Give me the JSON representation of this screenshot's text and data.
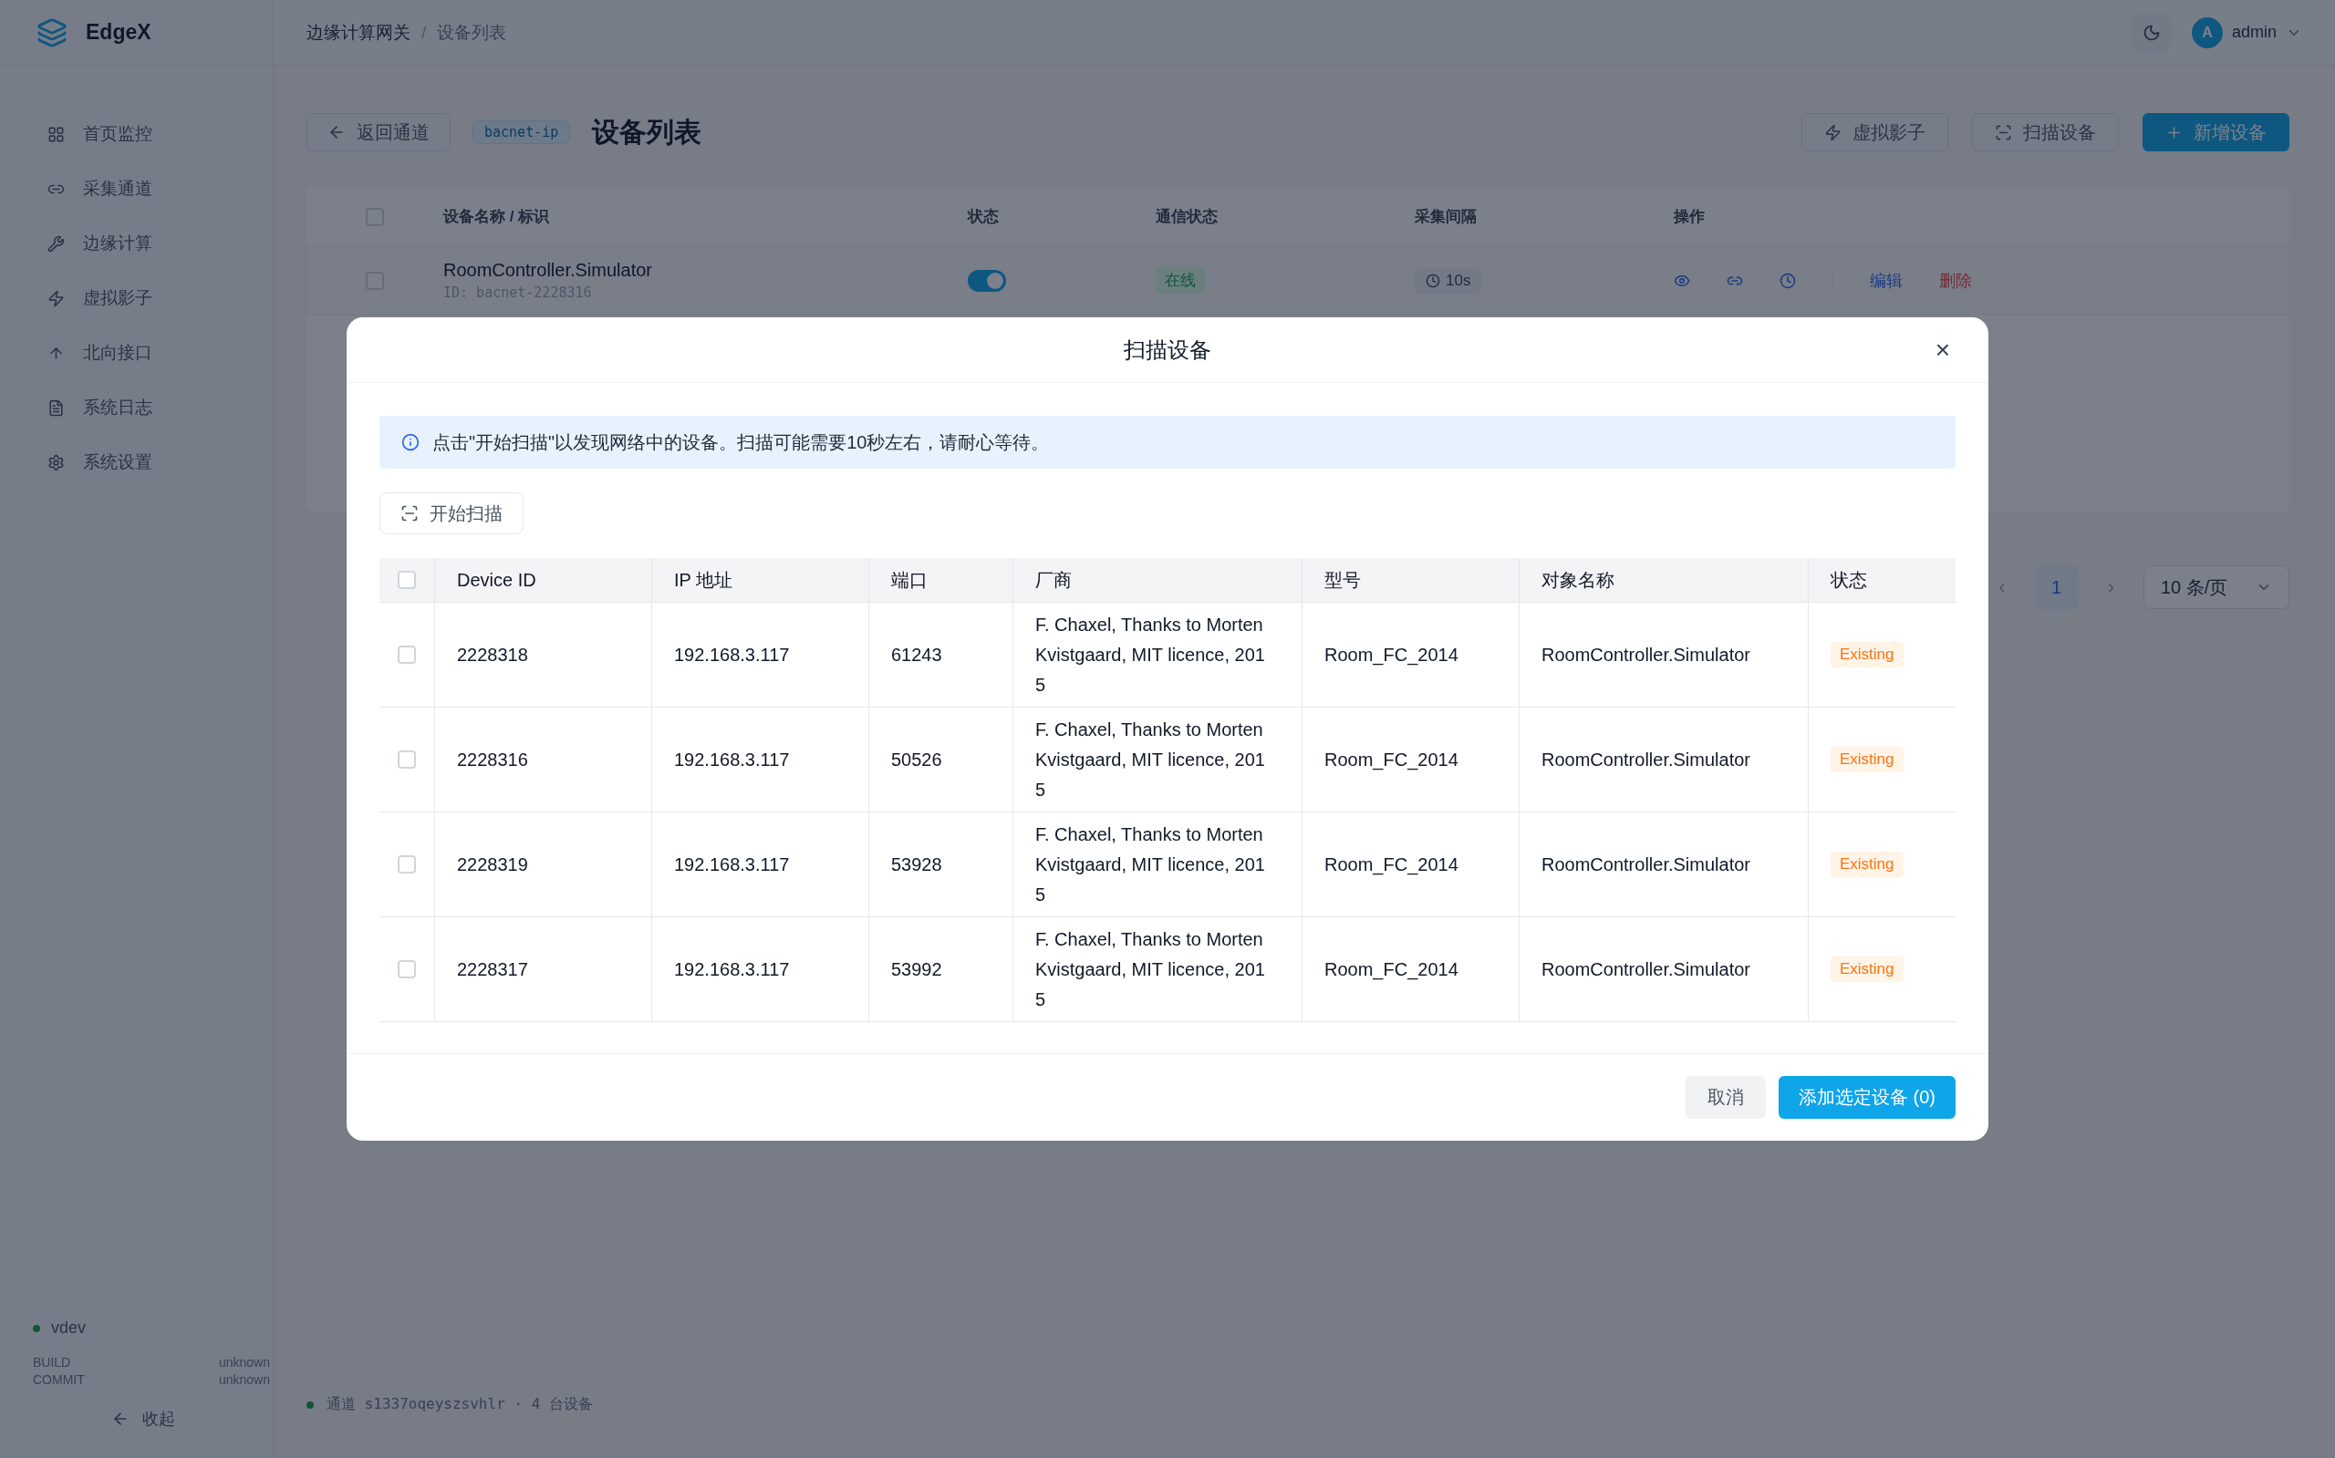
{
  "brand": {
    "name": "EdgeX"
  },
  "sidebar": {
    "items": [
      {
        "label": "首页监控"
      },
      {
        "label": "采集通道"
      },
      {
        "label": "边缘计算"
      },
      {
        "label": "虚拟影子"
      },
      {
        "label": "北向接口"
      },
      {
        "label": "系统日志"
      },
      {
        "label": "系统设置"
      }
    ],
    "version": "vdev",
    "build_label": "BUILD",
    "build_value": "unknown",
    "commit_label": "COMMIT",
    "commit_value": "unknown",
    "collapse": "收起"
  },
  "header": {
    "breadcrumb": [
      "边缘计算网关",
      "设备列表"
    ],
    "separator": "/",
    "user": {
      "avatar": "A",
      "name": "admin"
    }
  },
  "toolbar": {
    "back": "返回通道",
    "protocol_tag": "bacnet-ip",
    "title": "设备列表",
    "actions": [
      {
        "label": "虚拟影子",
        "kind": "outline"
      },
      {
        "label": "扫描设备",
        "kind": "outline"
      },
      {
        "label": "新增设备",
        "kind": "primary"
      }
    ]
  },
  "device_table": {
    "select_all_checked": false,
    "columns": [
      "设备名称 / 标识",
      "状态",
      "通信状态",
      "采集间隔",
      "操作"
    ],
    "rows": [
      {
        "checked": false,
        "name": "RoomController.Simulator",
        "id": "ID: bacnet-2228316",
        "on": true,
        "comm": "在线",
        "interval": "10s",
        "edit": "编辑",
        "delete": "删除"
      }
    ]
  },
  "pagination": {
    "prev": "‹",
    "next": "›",
    "pages": [
      {
        "label": "1",
        "selected": true
      }
    ],
    "page_size": "10 条/页"
  },
  "status_bar": {
    "text": "通道 s1337oqeyszsvhlr · 4 台设备"
  },
  "dialog": {
    "title": "扫描设备",
    "close": "×",
    "info": "点击\"开始扫描\"以发现网络中的设备。扫描可能需要10秒左右，请耐心等待。",
    "scan_button": "开始扫描",
    "select_all_checked": false,
    "columns": [
      "Device ID",
      "IP 地址",
      "端口",
      "厂商",
      "型号",
      "对象名称",
      "状态"
    ],
    "rows": [
      {
        "checked": false,
        "device_id": "2228318",
        "ip": "192.168.3.117",
        "port": "61243",
        "vendor": "F. Chaxel, Thanks to Morten Kvistgaard, MIT licence, 2015",
        "model": "Room_FC_2014",
        "object": "RoomController.Simulator",
        "status": "Existing"
      },
      {
        "checked": false,
        "device_id": "2228316",
        "ip": "192.168.3.117",
        "port": "50526",
        "vendor": "F. Chaxel, Thanks to Morten Kvistgaard, MIT licence, 2015",
        "model": "Room_FC_2014",
        "object": "RoomController.Simulator",
        "status": "Existing"
      },
      {
        "checked": false,
        "device_id": "2228319",
        "ip": "192.168.3.117",
        "port": "53928",
        "vendor": "F. Chaxel, Thanks to Morten Kvistgaard, MIT licence, 2015",
        "model": "Room_FC_2014",
        "object": "RoomController.Simulator",
        "status": "Existing"
      },
      {
        "checked": false,
        "device_id": "2228317",
        "ip": "192.168.3.117",
        "port": "53992",
        "vendor": "F. Chaxel, Thanks to Morten Kvistgaard, MIT licence, 2015",
        "model": "Room_FC_2014",
        "object": "RoomController.Simulator",
        "status": "Existing"
      }
    ],
    "cancel": "取消",
    "confirm": "添加选定设备 (0)"
  }
}
